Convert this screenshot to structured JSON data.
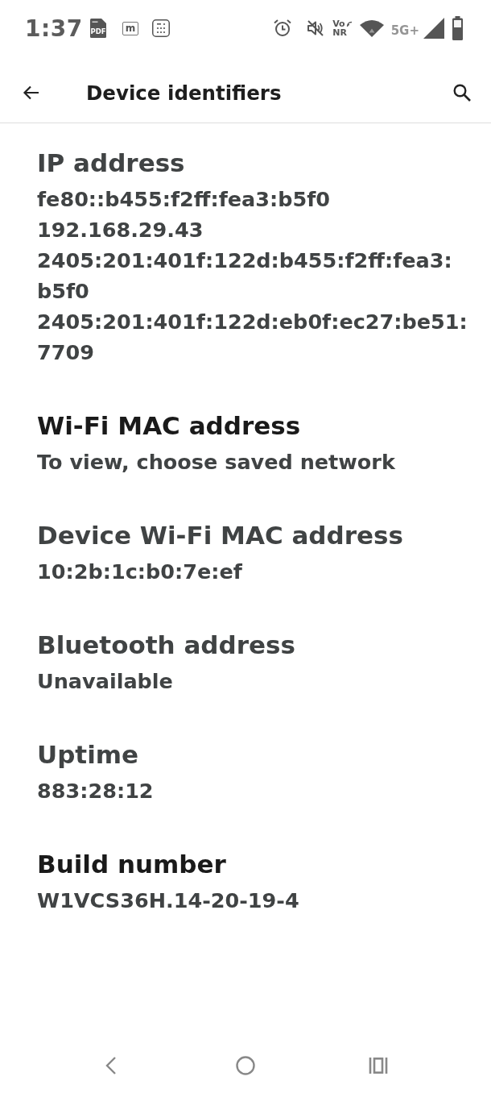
{
  "status_bar": {
    "time": "1:37",
    "notifications": [
      {
        "kind": "pdf",
        "label": "PDF"
      },
      {
        "kind": "letter",
        "label": "m"
      },
      {
        "kind": "calculator"
      }
    ],
    "indicators": [
      {
        "kind": "alarm"
      },
      {
        "kind": "muted"
      },
      {
        "kind": "vonr",
        "top": "Vo",
        "bottom": "NR"
      },
      {
        "kind": "wifi"
      },
      {
        "kind": "network",
        "label": "5G+",
        "dimmed": true
      },
      {
        "kind": "signal"
      },
      {
        "kind": "battery"
      }
    ]
  },
  "app_bar": {
    "title": "Device identifiers"
  },
  "items": [
    {
      "title": "IP address",
      "clickable": false,
      "values": [
        "fe80::b455:f2ff:fea3:b5f0",
        "192.168.29.43",
        "2405:201:401f:122d:b455:f2ff:fea3:b5f0",
        "2405:201:401f:122d:eb0f:ec27:be51:7709"
      ]
    },
    {
      "title": "Wi-Fi MAC address",
      "clickable": true,
      "values": [
        "To view, choose saved network"
      ]
    },
    {
      "title": "Device Wi-Fi MAC address",
      "clickable": false,
      "values": [
        "10:2b:1c:b0:7e:ef"
      ]
    },
    {
      "title": "Bluetooth address",
      "clickable": false,
      "values": [
        "Unavailable"
      ]
    },
    {
      "title": "Uptime",
      "clickable": false,
      "values": [
        "883:28:12"
      ]
    },
    {
      "title": "Build number",
      "clickable": true,
      "values": [
        "W1VCS36H.14-20-19-4"
      ]
    }
  ]
}
